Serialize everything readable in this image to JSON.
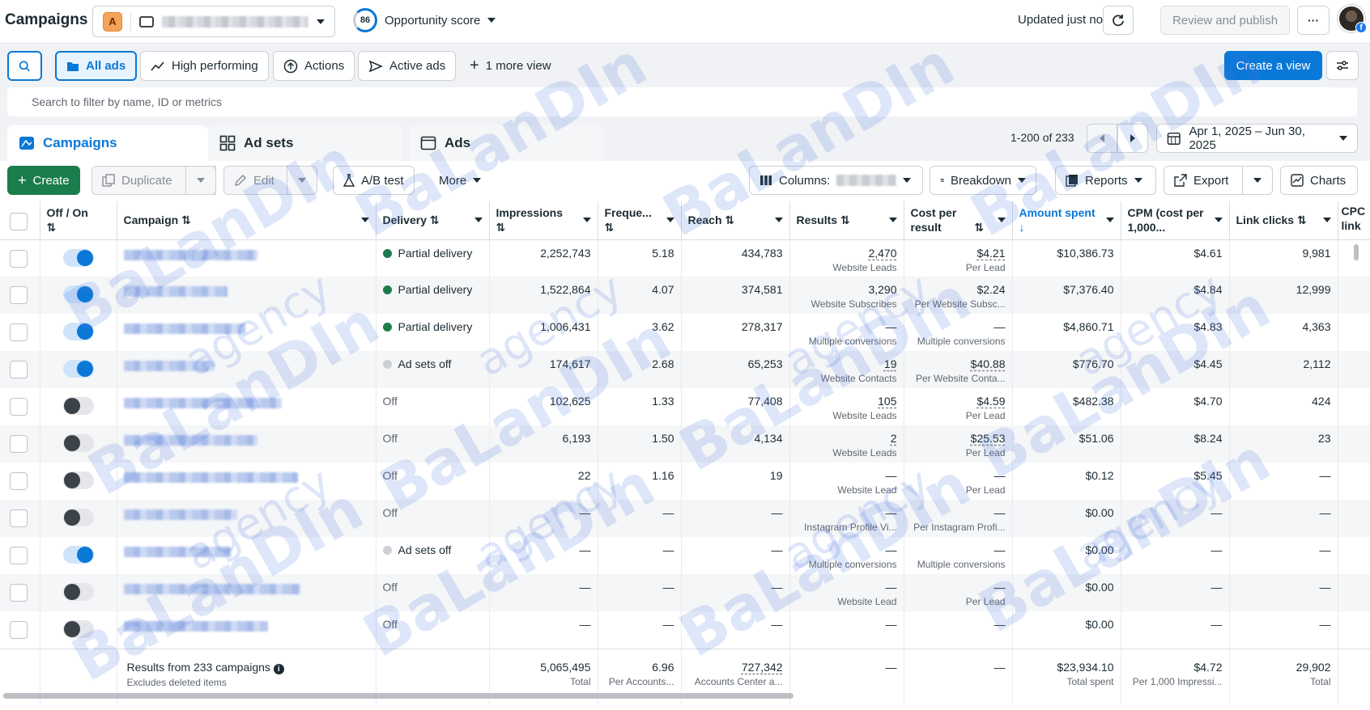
{
  "header": {
    "title": "Campaigns",
    "account_letter": "A",
    "opportunity_score": "86",
    "opportunity_label": "Opportunity score",
    "updated": "Updated just now",
    "review_publish": "Review and publish",
    "more": "···"
  },
  "views": {
    "all_ads": "All ads",
    "high_performing": "High performing",
    "actions": "Actions",
    "active_ads": "Active ads",
    "more_view": "1 more view",
    "create_view": "Create a view"
  },
  "search": {
    "placeholder": "Search to filter by name, ID or metrics"
  },
  "tabs": {
    "campaigns": "Campaigns",
    "ad_sets": "Ad sets",
    "ads": "Ads"
  },
  "pager": {
    "range": "1-200 of 233"
  },
  "date_range": "Apr 1, 2025 – Jun 30, 2025",
  "toolbar": {
    "create": "Create",
    "duplicate": "Duplicate",
    "edit": "Edit",
    "ab_test": "A/B test",
    "more": "More",
    "columns": "Columns:",
    "breakdown": "Breakdown",
    "reports": "Reports",
    "export": "Export",
    "charts": "Charts"
  },
  "columns": {
    "off_on": "Off / On",
    "campaign": "Campaign",
    "delivery": "Delivery",
    "impressions": "Impressions",
    "frequency": "Freque...",
    "reach": "Reach",
    "results": "Results",
    "cost_per_result": "Cost per result",
    "amount_spent": "Amount spent",
    "cpm": "CPM (cost per 1,000...",
    "link_clicks": "Link clicks",
    "cpc": "CPC link"
  },
  "rows": [
    {
      "on": true,
      "w": 165,
      "delivery": "Partial delivery",
      "status": "green",
      "impressions": "2,252,743",
      "frequency": "5.18",
      "reach": "434,783",
      "results": "2,470",
      "results_ul": true,
      "results_sub": "Website Leads",
      "cost": "$4.21",
      "cost_ul": true,
      "cost_sub": "Per Lead",
      "spent": "$10,386.73",
      "cpm": "$4.61",
      "clicks": "9,981"
    },
    {
      "on": true,
      "w": 128,
      "delivery": "Partial delivery",
      "status": "green",
      "impressions": "1,522,864",
      "frequency": "4.07",
      "reach": "374,581",
      "results": "3,290",
      "results_ul": false,
      "results_sub": "Website Subscribes",
      "cost": "$2.24",
      "cost_ul": false,
      "cost_sub": "Per Website Subsc...",
      "spent": "$7,376.40",
      "cpm": "$4.84",
      "clicks": "12,999"
    },
    {
      "on": true,
      "w": 150,
      "delivery": "Partial delivery",
      "status": "green",
      "impressions": "1,006,431",
      "frequency": "3.62",
      "reach": "278,317",
      "results": "—",
      "results_ul": false,
      "results_sub": "Multiple conversions",
      "cost": "—",
      "cost_ul": false,
      "cost_sub": "Multiple conversions",
      "spent": "$4,860.71",
      "cpm": "$4.83",
      "clicks": "4,363"
    },
    {
      "on": true,
      "w": 112,
      "delivery": "Ad sets off",
      "status": "grey",
      "impressions": "174,617",
      "frequency": "2.68",
      "reach": "65,253",
      "results": "19",
      "results_ul": true,
      "results_sub": "Website Contacts",
      "cost": "$40.88",
      "cost_ul": true,
      "cost_sub": "Per Website Conta...",
      "spent": "$776.70",
      "cpm": "$4.45",
      "clicks": "2,112"
    },
    {
      "on": false,
      "w": 195,
      "delivery": "Off",
      "status": "off",
      "impressions": "102,625",
      "frequency": "1.33",
      "reach": "77,408",
      "results": "105",
      "results_ul": true,
      "results_sub": "Website Leads",
      "cost": "$4.59",
      "cost_ul": true,
      "cost_sub": "Per Lead",
      "spent": "$482.38",
      "cpm": "$4.70",
      "clicks": "424"
    },
    {
      "on": false,
      "w": 165,
      "delivery": "Off",
      "status": "off",
      "impressions": "6,193",
      "frequency": "1.50",
      "reach": "4,134",
      "results": "2",
      "results_ul": true,
      "results_sub": "Website Leads",
      "cost": "$25.53",
      "cost_ul": true,
      "cost_sub": "Per Lead",
      "spent": "$51.06",
      "cpm": "$8.24",
      "clicks": "23"
    },
    {
      "on": false,
      "w": 215,
      "delivery": "Off",
      "status": "off",
      "impressions": "22",
      "frequency": "1.16",
      "reach": "19",
      "results": "—",
      "results_ul": false,
      "results_sub": "Website Lead",
      "cost": "—",
      "cost_ul": false,
      "cost_sub": "Per Lead",
      "spent": "$0.12",
      "cpm": "$5.45",
      "clicks": "—"
    },
    {
      "on": false,
      "w": 140,
      "delivery": "Off",
      "status": "off",
      "impressions": "—",
      "frequency": "—",
      "reach": "—",
      "results": "—",
      "results_ul": false,
      "results_sub": "Instagram Profile Vi...",
      "cost": "—",
      "cost_ul": false,
      "cost_sub": "Per Instagram Profi...",
      "spent": "$0.00",
      "cpm": "—",
      "clicks": "—"
    },
    {
      "on": true,
      "w": 132,
      "delivery": "Ad sets off",
      "status": "grey",
      "impressions": "—",
      "frequency": "—",
      "reach": "—",
      "results": "—",
      "results_ul": false,
      "results_sub": "Multiple conversions",
      "cost": "—",
      "cost_ul": false,
      "cost_sub": "Multiple conversions",
      "spent": "$0.00",
      "cpm": "—",
      "clicks": "—"
    },
    {
      "on": false,
      "w": 218,
      "delivery": "Off",
      "status": "off",
      "impressions": "—",
      "frequency": "—",
      "reach": "—",
      "results": "—",
      "results_ul": false,
      "results_sub": "Website Lead",
      "cost": "—",
      "cost_ul": false,
      "cost_sub": "Per Lead",
      "spent": "$0.00",
      "cpm": "—",
      "clicks": "—"
    },
    {
      "on": false,
      "w": 178,
      "delivery": "Off",
      "status": "off",
      "impressions": "—",
      "frequency": "—",
      "reach": "—",
      "results": "—",
      "results_ul": false,
      "results_sub": "",
      "cost": "—",
      "cost_ul": false,
      "cost_sub": "",
      "spent": "$0.00",
      "cpm": "—",
      "clicks": "—"
    }
  ],
  "totals": {
    "label": "Results from 233 campaigns",
    "sub": "Excludes deleted items",
    "impressions": "5,065,495",
    "impressions_sub": "Total",
    "frequency": "6.96",
    "frequency_sub": "Per Accounts...",
    "reach": "727,342",
    "reach_sub": "Accounts Center a...",
    "results": "—",
    "cost": "—",
    "spent": "$23,934.10",
    "spent_sub": "Total spent",
    "cpm": "$4.72",
    "cpm_sub": "Per 1,000 Impressi...",
    "clicks": "29,902",
    "clicks_sub": "Total"
  },
  "watermark": {
    "brand": "BaLanDIn",
    "sub": "agency"
  }
}
